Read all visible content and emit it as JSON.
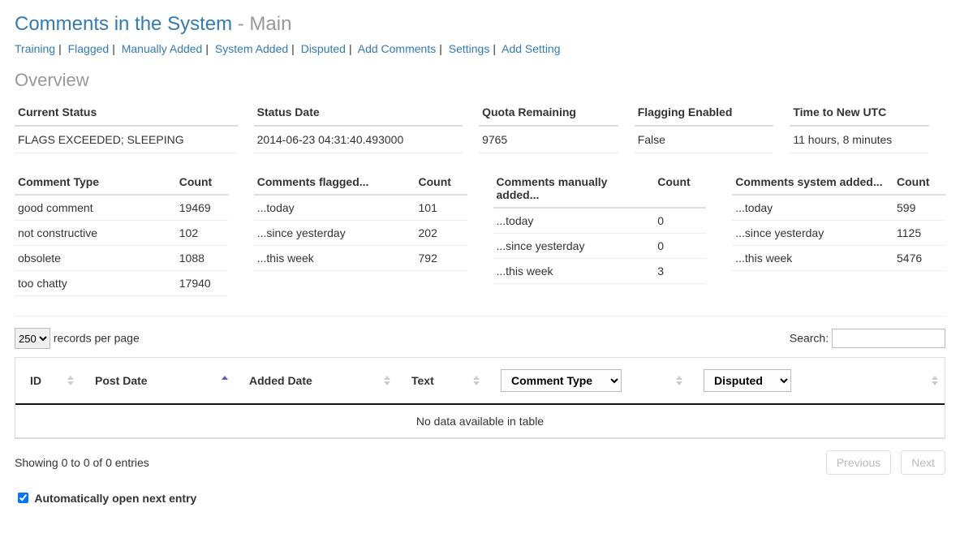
{
  "header": {
    "title_main": "Comments in the System",
    "title_sep": " - ",
    "title_sub": "Main"
  },
  "nav": [
    "Training",
    "Flagged",
    "Manually Added",
    "System Added",
    "Disputed",
    "Add Comments",
    "Settings",
    "Add Setting"
  ],
  "overview_heading": "Overview",
  "status": {
    "headers": {
      "current_status": "Current Status",
      "status_date": "Status Date",
      "quota_remaining": "Quota Remaining",
      "flagging_enabled": "Flagging Enabled",
      "time_to_new_utc": "Time to New UTC"
    },
    "values": {
      "current_status": "FLAGS EXCEEDED; SLEEPING",
      "status_date": "2014-06-23 04:31:40.493000",
      "quota_remaining": "9765",
      "flagging_enabled": "False",
      "time_to_new_utc": "11 hours, 8 minutes"
    }
  },
  "stats": {
    "comment_type": {
      "title": "Comment Type",
      "count_label": "Count",
      "rows": [
        {
          "label": "good comment",
          "count": "19469"
        },
        {
          "label": "not constructive",
          "count": "102"
        },
        {
          "label": "obsolete",
          "count": "1088"
        },
        {
          "label": "too chatty",
          "count": "17940"
        }
      ]
    },
    "flagged": {
      "title": "Comments flagged...",
      "count_label": "Count",
      "rows": [
        {
          "label": "...today",
          "count": "101"
        },
        {
          "label": "...since yesterday",
          "count": "202"
        },
        {
          "label": "...this week",
          "count": "792"
        }
      ]
    },
    "manual": {
      "title": "Comments manually added...",
      "count_label": "Count",
      "rows": [
        {
          "label": "...today",
          "count": "0"
        },
        {
          "label": "...since yesterday",
          "count": "0"
        },
        {
          "label": "...this week",
          "count": "3"
        }
      ]
    },
    "system": {
      "title": "Comments system added...",
      "count_label": "Count",
      "rows": [
        {
          "label": "...today",
          "count": "599"
        },
        {
          "label": "...since yesterday",
          "count": "1125"
        },
        {
          "label": "...this week",
          "count": "5476"
        }
      ]
    }
  },
  "datatable": {
    "length_value": "250",
    "length_suffix": " records per page",
    "search_label": "Search: ",
    "columns": {
      "id": "ID",
      "post_date": "Post Date",
      "added_date": "Added Date",
      "text": "Text",
      "comment_type_selected": "Comment Type",
      "disputed_selected": "Disputed"
    },
    "empty_text": "No data available in table",
    "info_text": "Showing 0 to 0 of 0 entries",
    "prev_label": "Previous",
    "next_label": "Next"
  },
  "auto_open": {
    "label": "Automatically open next entry",
    "checked": true
  }
}
